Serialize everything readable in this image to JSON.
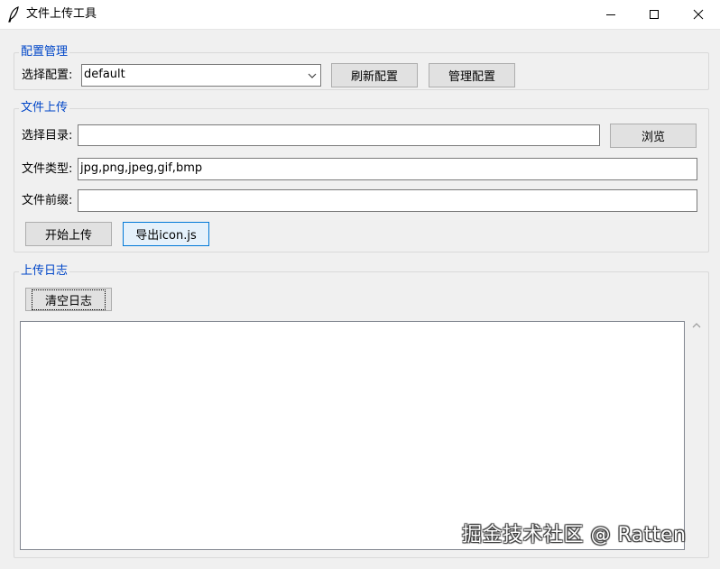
{
  "window": {
    "title": "文件上传工具",
    "icon": "feather-icon",
    "controls": [
      "minimize-icon",
      "maximize-icon",
      "close-icon"
    ]
  },
  "config_section": {
    "legend": "配置管理",
    "select_label": "选择配置:",
    "selected_value": "default",
    "refresh_button": "刷新配置",
    "manage_button": "管理配置"
  },
  "upload_section": {
    "legend": "文件上传",
    "dir_label": "选择目录:",
    "dir_value": "",
    "browse_button": "浏览",
    "type_label": "文件类型:",
    "type_value": "jpg,png,jpeg,gif,bmp",
    "prefix_label": "文件前缀:",
    "prefix_value": "",
    "start_button": "开始上传",
    "export_button": "导出icon.js"
  },
  "log_section": {
    "legend": "上传日志",
    "clear_button": "清空日志",
    "log_text": ""
  },
  "watermark": "掘金技术社区 @ Ratten",
  "colors": {
    "legend_text": "#0046c8",
    "window_bg": "#f0f0f0",
    "button_bg": "#e1e1e1",
    "focus_border": "#0078d7"
  }
}
